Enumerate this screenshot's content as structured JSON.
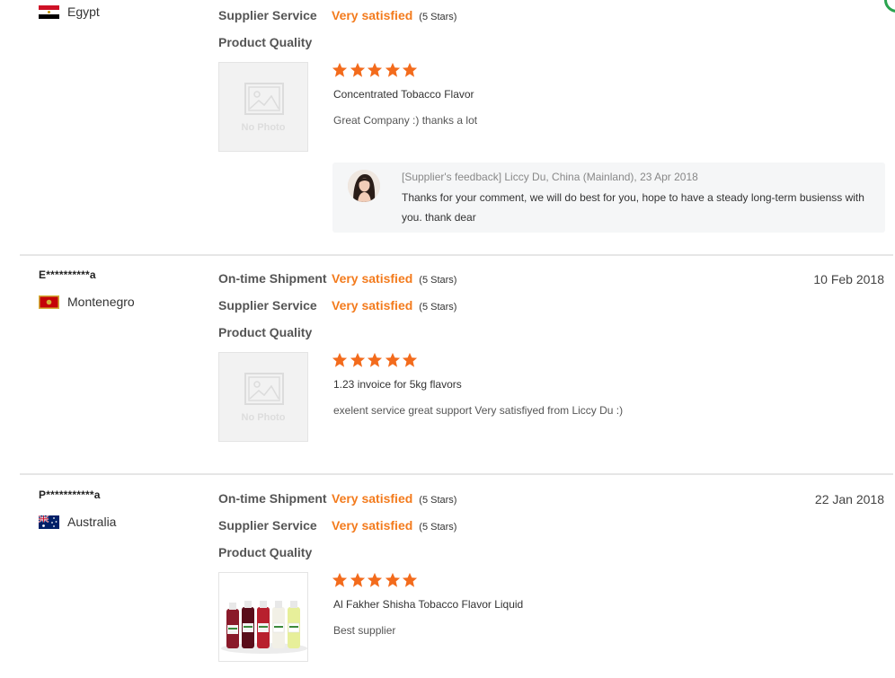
{
  "reviews": [
    {
      "buyer": "",
      "country": "Egypt",
      "date": "",
      "ratings": [
        {
          "label": "Supplier Service",
          "value": "Very satisfied",
          "stars": "(5 Stars)"
        },
        {
          "label": "Product Quality",
          "value": "",
          "stars": ""
        }
      ],
      "photo": "No Photo",
      "product_stars": 5,
      "product": "Concentrated Tobacco Flavor",
      "comment": "Great Company :) thanks a lot",
      "feedback": {
        "meta": "[Supplier's feedback] Liccy Du, China (Mainland), 23 Apr 2018",
        "text": "Thanks for your comment, we will do best for you, hope to have a steady long-term busienss with you. thank dear"
      }
    },
    {
      "buyer": "E**********a",
      "country": "Montenegro",
      "date": "10 Feb 2018",
      "ratings": [
        {
          "label": "On-time Shipment",
          "value": "Very satisfied",
          "stars": "(5 Stars)"
        },
        {
          "label": "Supplier Service",
          "value": "Very satisfied",
          "stars": "(5 Stars)"
        },
        {
          "label": "Product Quality",
          "value": "",
          "stars": ""
        }
      ],
      "photo": "No Photo",
      "product_stars": 5,
      "product": "1.23 invoice for 5kg flavors",
      "comment": "exelent service great support Very satisfiyed from Liccy Du :)"
    },
    {
      "buyer": "P***********a",
      "country": "Australia",
      "date": "22 Jan 2018",
      "ratings": [
        {
          "label": "On-time Shipment",
          "value": "Very satisfied",
          "stars": "(5 Stars)"
        },
        {
          "label": "Supplier Service",
          "value": "Very satisfied",
          "stars": "(5 Stars)"
        },
        {
          "label": "Product Quality",
          "value": "",
          "stars": ""
        }
      ],
      "product_stars": 5,
      "product": "Al Fakher Shisha Tobacco Flavor Liquid",
      "comment": "Best supplier"
    }
  ],
  "colors": {
    "accent": "#f37b1d",
    "star": "#f36b1c",
    "divider": "#e6e6e6"
  }
}
